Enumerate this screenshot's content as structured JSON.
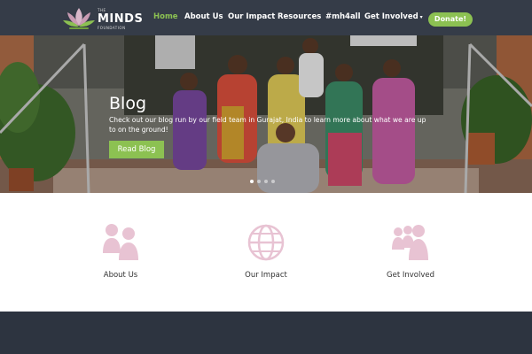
{
  "brand": {
    "the": "THE",
    "name": "MINDS",
    "foundation": "FOUNDATION"
  },
  "nav": {
    "items": [
      {
        "label": "Home",
        "active": true
      },
      {
        "label": "About Us",
        "active": false
      },
      {
        "label": "Our Impact",
        "active": false
      },
      {
        "label": "Resources",
        "active": false
      },
      {
        "label": "#mh4all",
        "active": false
      },
      {
        "label": "Get Involved",
        "active": false
      }
    ],
    "caret": "▾",
    "donate_label": "Donate!"
  },
  "hero": {
    "title": "Blog",
    "subtitle": "Check out our blog run by our field team in Gurajat, India to learn more about what we are up to on the ground!",
    "button_label": "Read Blog",
    "slide_count": 4,
    "active_slide": 1
  },
  "features": [
    {
      "label": "About Us",
      "icon": "people-icon"
    },
    {
      "label": "Our Impact",
      "icon": "globe-icon"
    },
    {
      "label": "Get Involved",
      "icon": "group-icon"
    }
  ],
  "colors": {
    "accent": "#8cc152",
    "header": "#353c48",
    "icon_pink": "#e8c3d3",
    "footer": "#2d3440"
  }
}
